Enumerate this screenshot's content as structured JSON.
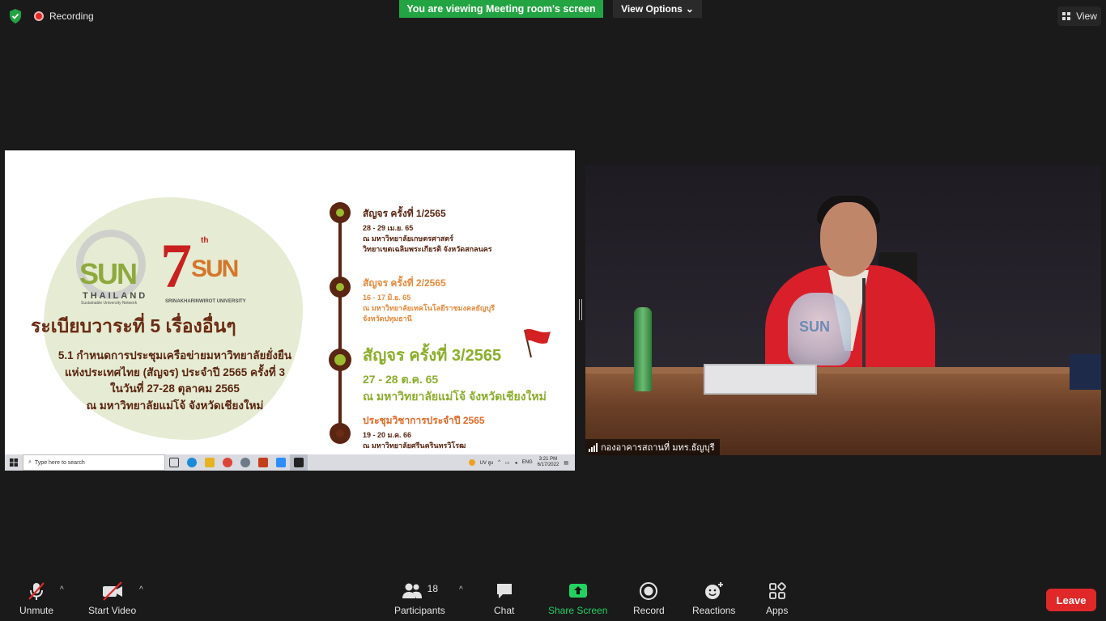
{
  "top": {
    "recording_label": "Recording",
    "viewing_banner": "You are viewing Meeting room's screen",
    "view_options_label": "View Options",
    "view_label": "View"
  },
  "slide": {
    "logo_sun_word": "SUN",
    "logo_sun_sub": "THAILAND",
    "logo_sun_tagline": "Sustainable University Network",
    "logo_7": "7",
    "logo_7_sup": "th",
    "logo_7_sun": "SUN",
    "logo_swu": "SRINAKHARINWIROT UNIVERSITY",
    "agenda_title": "ระเบียบวาระที่ 5 เรื่องอื่นๆ",
    "agenda_lines": [
      "5.1 กำหนดการประชุมเครือข่ายมหาวิทยาลัยยั่งยืน",
      "แห่งประเทศไทย (สัญจร) ประจำปี 2565 ครั้งที่ 3",
      "ในวันที่ 27-28 ตุลาคม 2565",
      "ณ มหาวิทยาลัยแม่โจ้ จังหวัดเชียงใหม่"
    ],
    "events": [
      {
        "title": "สัญจร ครั้งที่ 1/2565",
        "lines": [
          "28 - 29 เม.ย. 65",
          "ณ มหาวิทยาลัยเกษตรศาสตร์",
          "วิทยาเขตเฉลิมพระเกียรติ จังหวัดสกลนคร"
        ]
      },
      {
        "title": "สัญจร ครั้งที่ 2/2565",
        "lines": [
          "16 - 17 มิ.ย. 65",
          "ณ มหาวิทยาลัยเทคโนโลยีราชมงคลธัญบุรี",
          "จังหวัดปทุมธานี"
        ]
      },
      {
        "title": "สัญจร ครั้งที่ 3/2565",
        "lines": [
          "27 - 28 ต.ค. 65",
          "ณ มหาวิทยาลัยแม่โจ้ จังหวัดเชียงใหม่"
        ]
      },
      {
        "title": "ประชุมวิชาการประจำปี 2565",
        "lines": [
          "19 - 20 ม.ค. 66",
          "ณ มหาวิทยาลัยศรีนครินทรวิโรฒ"
        ]
      }
    ]
  },
  "taskbar": {
    "search_placeholder": "Type here to search",
    "tray_uv": "UV สูง",
    "tray_lang": "ENG",
    "time": "3:21 PM",
    "date": "6/17/2022"
  },
  "video": {
    "participant_name": "กองอาคารสถานที่ มทร.ธัญบุรี",
    "trophy_text": "SUN"
  },
  "toolbar": {
    "unmute": "Unmute",
    "start_video": "Start Video",
    "participants": "Participants",
    "participants_count": "18",
    "chat": "Chat",
    "share_screen": "Share Screen",
    "record": "Record",
    "reactions": "Reactions",
    "apps": "Apps",
    "leave": "Leave"
  },
  "colors": {
    "banner_green": "#23a443",
    "leave_red": "#e02828",
    "slide_brown": "#5a2511",
    "slide_green": "#8aae2a",
    "slide_orange": "#e68a3a"
  }
}
